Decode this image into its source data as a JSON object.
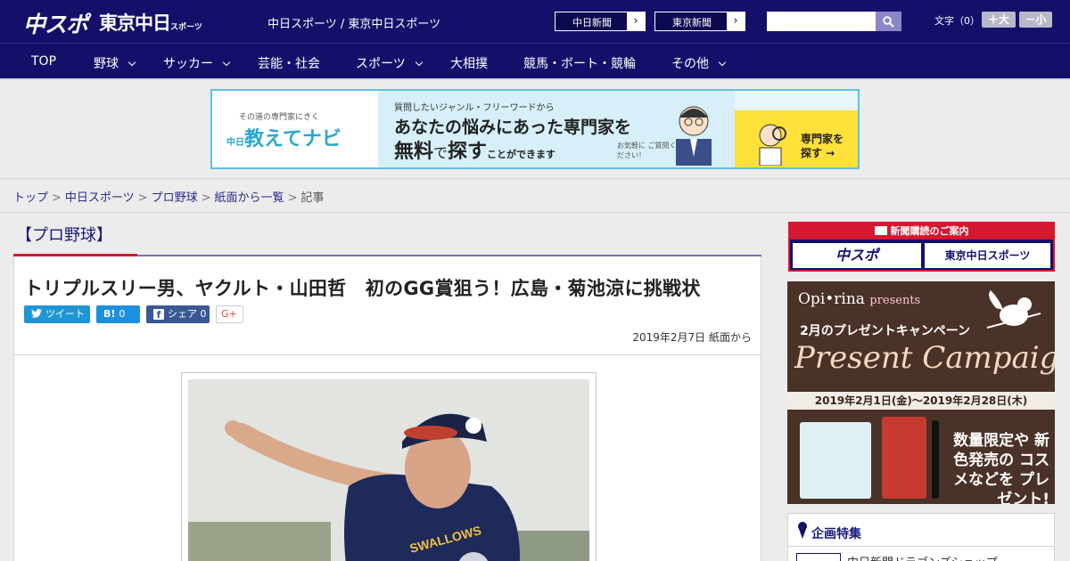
{
  "header": {
    "logo_chuspo": "中スポ",
    "logo_tokyo": "東京中日",
    "logo_tokyo_small": "スポーツ",
    "site_links": "中日スポーツ / 東京中日スポーツ",
    "paper_buttons": [
      "中日新聞",
      "東京新聞"
    ],
    "fontsize_label": "文字（0）",
    "fontsize_plus": "＋大",
    "fontsize_minus": "－小"
  },
  "nav": {
    "items": [
      {
        "label": "TOP",
        "dropdown": false
      },
      {
        "label": "野球",
        "dropdown": true
      },
      {
        "label": "サッカー",
        "dropdown": true
      },
      {
        "label": "芸能・社会",
        "dropdown": false
      },
      {
        "label": "スポーツ",
        "dropdown": true
      },
      {
        "label": "大相撲",
        "dropdown": false
      },
      {
        "label": "競馬・ボート・競輪",
        "dropdown": false
      },
      {
        "label": "その他",
        "dropdown": true
      }
    ]
  },
  "ad_banner": {
    "tagline": "その道の専門家にきく",
    "name": "教えてナビ",
    "name_prefix": "中日",
    "line1": "質問したいジャンル・フリーワードから",
    "line2": "あなたの悩みにあった専門家を",
    "line3_a": "無料",
    "line3_b": "で",
    "line3_c": "探す",
    "line3_d": "ことができます",
    "note": "お気軽に ご質問ください！",
    "cta": "専門家を 探す →"
  },
  "breadcrumb": {
    "items": [
      "トップ",
      "中日スポーツ",
      "プロ野球",
      "紙面から一覧"
    ],
    "current": "記事"
  },
  "article": {
    "category": "【プロ野球】",
    "headline": "トリプルスリー男、ヤクルト・山田哲　初のGG賞狙う！広島・菊池涼に挑戦状",
    "share": {
      "tweet": "ツイート",
      "hatena_icon": "B!",
      "hatena_count": "0",
      "facebook": "シェア",
      "facebook_count": "0",
      "gplus": "G+"
    },
    "date": "2019年2月7日 紙面から"
  },
  "sidebar": {
    "subscription_title": "新聞購読のご案内",
    "subscription_buttons": [
      "中スポ",
      "東京中日スポーツ"
    ],
    "ad": {
      "brand": "Opi•rina",
      "brand_suffix": "presents",
      "campaign": "2月のプレゼントキャンペーン",
      "present": "Present Campaign",
      "dates": "2019年2月1日(金)～2019年2月28日(木)",
      "promo": "数量限定や 新色発売の コスメなどを プレゼント!"
    },
    "features": {
      "title": "企画特集",
      "item": "中日新聞ドラゴンズショップ"
    }
  },
  "colors": {
    "header_bg": "#14106a",
    "accent_red": "#d3182f",
    "twitter": "#1e96d6",
    "hatena": "#1e8fdf",
    "facebook": "#3a5795"
  }
}
